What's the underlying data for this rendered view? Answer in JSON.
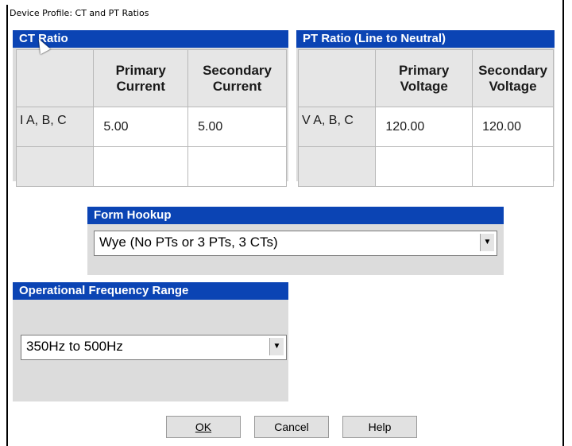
{
  "window": {
    "title": "Device Profile: CT and PT Ratios"
  },
  "ct_ratio": {
    "header": "CT Ratio",
    "columns": [
      "Primary Current",
      "Secondary Current"
    ],
    "rows": [
      {
        "label": "I A, B, C",
        "primary": "5.00",
        "secondary": "5.00"
      },
      {
        "label": "",
        "primary": "",
        "secondary": ""
      }
    ]
  },
  "pt_ratio": {
    "header": "PT Ratio (Line to Neutral)",
    "columns": [
      "Primary Voltage",
      "Secondary Voltage"
    ],
    "rows": [
      {
        "label": "V A, B, C",
        "primary": "120.00",
        "secondary": "120.00"
      },
      {
        "label": "",
        "primary": "",
        "secondary": ""
      }
    ]
  },
  "form_hookup": {
    "header": "Form Hookup",
    "selected": "Wye (No PTs or 3 PTs, 3 CTs)"
  },
  "frequency": {
    "header": "Operational Frequency Range",
    "selected": "350Hz to 500Hz"
  },
  "buttons": {
    "ok": "OK",
    "cancel": "Cancel",
    "help": "Help"
  },
  "icons": [
    "dropdown-arrow-icon",
    "mouse-cursor-icon"
  ],
  "colors": {
    "header_bg": "#0b44b4",
    "panel_bg": "#dcdcdc"
  }
}
